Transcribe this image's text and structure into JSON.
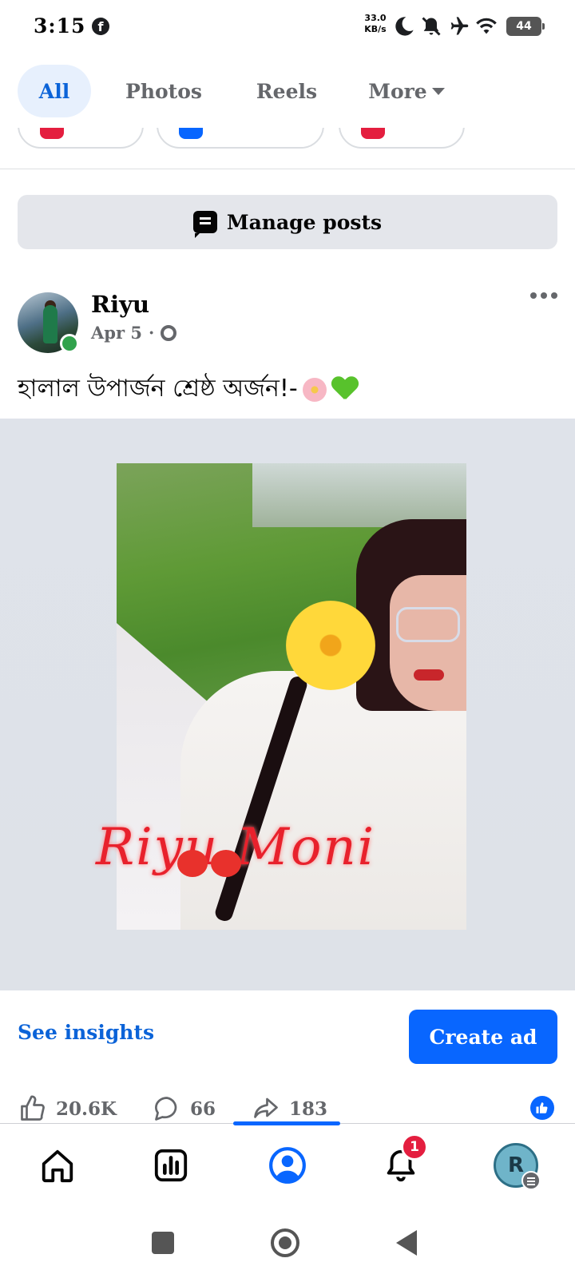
{
  "status_bar": {
    "time": "3:15",
    "facebook_badge": "f",
    "net_speed_value": "33.0",
    "net_speed_unit": "KB/s",
    "battery": "44",
    "icons": [
      "moon-icon",
      "bell-off-icon",
      "airplane-icon",
      "wifi-icon",
      "battery-icon"
    ]
  },
  "tabs": [
    {
      "label": "All",
      "selected": true
    },
    {
      "label": "Photos",
      "selected": false
    },
    {
      "label": "Reels",
      "selected": false
    },
    {
      "label": "More",
      "selected": false
    }
  ],
  "manage_posts": {
    "label": "Manage posts"
  },
  "post": {
    "author": "Riyu",
    "date": "Apr 5",
    "separator": "·",
    "caption": "হালাল উপার্জন শ্রেষ্ঠ অর্জন!-",
    "image_watermark": "Riyu Moni"
  },
  "insights": {
    "see_insights": "See insights",
    "create_ad": "Create ad"
  },
  "reactions": {
    "likes": "20.6K",
    "comments": "66",
    "shares": "183"
  },
  "nav": {
    "notification_count": "1",
    "profile_initial": "R",
    "active_tab": "profile"
  },
  "colors": {
    "accent": "#0866ff",
    "tab_selected_bg": "#e7f0fd",
    "tab_selected_text": "#0b63d8",
    "secondary_text": "#65676b",
    "badge_red": "#e41e3f",
    "online_green": "#31a24c"
  }
}
